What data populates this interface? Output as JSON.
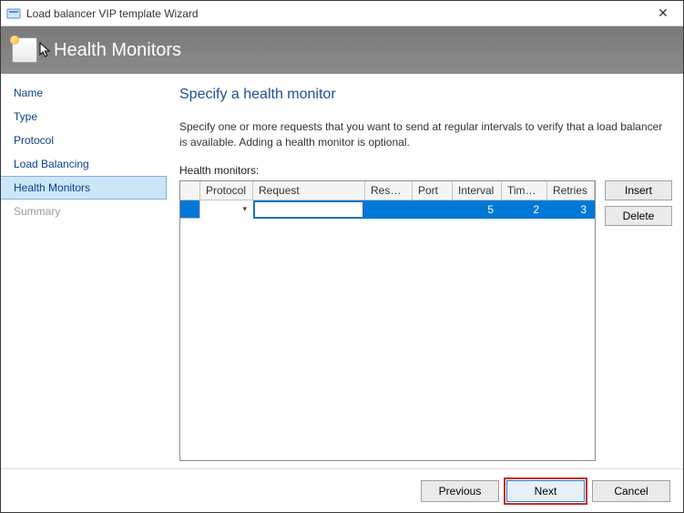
{
  "window": {
    "title": "Load balancer VIP template Wizard",
    "close_label": "✕"
  },
  "banner": {
    "title": "Health Monitors"
  },
  "sidebar": {
    "items": [
      {
        "label": "Name"
      },
      {
        "label": "Type"
      },
      {
        "label": "Protocol"
      },
      {
        "label": "Load Balancing"
      },
      {
        "label": "Health Monitors"
      },
      {
        "label": "Summary"
      }
    ]
  },
  "main": {
    "heading": "Specify a health monitor",
    "description": "Specify one or more requests that you want to send at regular intervals to verify that a load balancer is available. Adding a health monitor is optional.",
    "grid_label": "Health monitors:",
    "columns": {
      "protocol": "Protocol",
      "request": "Request",
      "response": "Respo...",
      "port": "Port",
      "interval": "Interval",
      "timeout": "Time-...",
      "retries": "Retries"
    },
    "rows": [
      {
        "protocol": "",
        "request": "",
        "response": "",
        "port": "",
        "interval": "5",
        "timeout": "2",
        "retries": "3"
      }
    ],
    "buttons": {
      "insert": "Insert",
      "delete": "Delete"
    }
  },
  "footer": {
    "previous": "Previous",
    "next": "Next",
    "cancel": "Cancel"
  }
}
